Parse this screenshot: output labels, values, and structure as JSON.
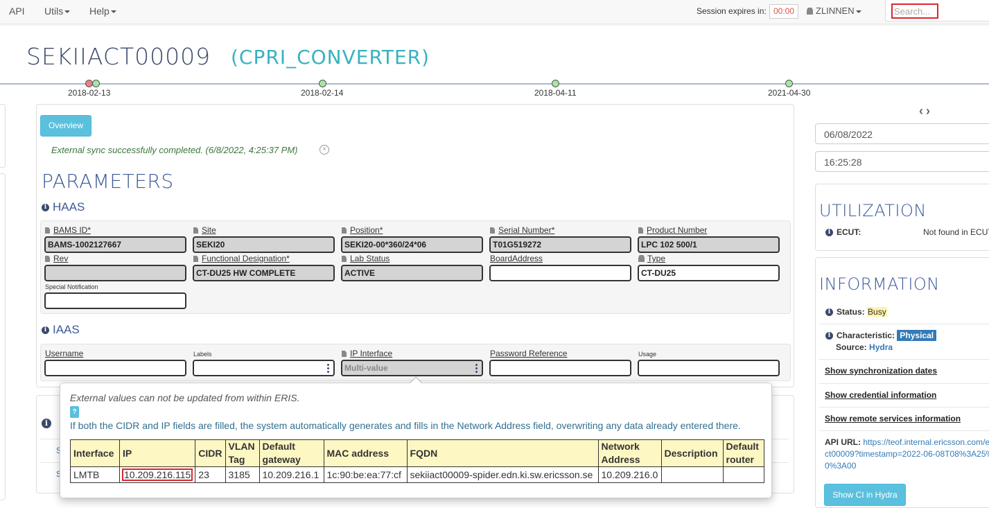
{
  "nav": {
    "api": "API",
    "utils": "Utils",
    "help": "Help",
    "session_label": "Session expires in:",
    "session_timer": "00:00",
    "user": "ZLINNEN",
    "search_placeholder": "Search..."
  },
  "ci": {
    "name": "SEKIIACT00009",
    "type": "(CPRI_CONVERTER)"
  },
  "timeline": {
    "dates": [
      "2018-02-13",
      "2018-02-14",
      "2018-04-11",
      "2021-04-30"
    ],
    "colors": {
      "red": "#f08080",
      "green": "#a8e6a0"
    }
  },
  "main": {
    "overview_button": "Overview",
    "sync_message": "External sync successfully completed. (6/8/2022, 4:25:37 PM)",
    "parameters_heading": "PARAMETERS",
    "haas": {
      "heading": "HAAS",
      "fields": [
        {
          "label": "BAMS ID*",
          "value": "BAMS-1002127667"
        },
        {
          "label": "Site",
          "value": "SEKI20"
        },
        {
          "label": "Position*",
          "value": "SEKI20-00*360/24*06"
        },
        {
          "label": "Serial Number*",
          "value": "T01G519272"
        },
        {
          "label": "Product Number",
          "value": "LPC 102 500/1"
        },
        {
          "label": "Rev",
          "value": ""
        },
        {
          "label": "Functional Designation*",
          "value": "CT-DU25 HW COMPLETE"
        },
        {
          "label": "Lab Status",
          "value": "ACTIVE"
        },
        {
          "label": "BoardAddress",
          "value": ""
        },
        {
          "label": "Type",
          "value": "CT-DU25"
        },
        {
          "label": "Special Notification",
          "value": ""
        }
      ]
    },
    "iaas": {
      "heading": "IAAS",
      "fields": [
        {
          "label": "Username",
          "value": ""
        },
        {
          "label": "Labels",
          "value": ""
        },
        {
          "label": "IP Interface",
          "value": "Multi-value"
        },
        {
          "label": "Password Reference",
          "value": ""
        },
        {
          "label": "Usage",
          "value": ""
        }
      ]
    }
  },
  "right": {
    "date": "06/08/2022",
    "time": "16:25:28",
    "utilization": {
      "heading": "UTILIZATION",
      "ecut_label": "ECUT:",
      "ecut_value": "Not found in ECUT"
    },
    "information": {
      "heading": "INFORMATION",
      "status_label": "Status:",
      "status_value": "Busy",
      "characteristic_label": "Characteristic:",
      "characteristic_value": "Physical",
      "source_label": "Source:",
      "source_value": "Hydra",
      "link_sync": "Show synchronization dates",
      "link_cred": "Show credential information",
      "link_remote": "Show remote services information",
      "api_label": "API URL:",
      "api_line1": "https://teof.internal.ericsson.com/e",
      "api_line2": "ct00009?timestamp=2022-06-08T08%3A25%",
      "api_line3": "0%3A00",
      "hydra_button": "Show CI in Hydra"
    }
  },
  "popover": {
    "note": "External values can not be updated from within ERIS.",
    "help_badge": "?",
    "description": "If both the CIDR and IP fields are filled, the system automatically generates and fills in the Network Address field, overwriting any data already entered there.",
    "table": {
      "headers": [
        "Interface",
        "IP",
        "CIDR",
        "VLAN Tag",
        "Default gateway",
        "MAC address",
        "FQDN",
        "Network Address",
        "Description",
        "Default router"
      ],
      "row": [
        "LMTB",
        "10.209.216.115",
        "23",
        "3185",
        "10.209.216.1",
        "1c:90:be:ea:77:cf",
        "sekiiact00009-spider.edn.ki.sw.ericsson.se",
        "10.209.216.0",
        "",
        ""
      ]
    }
  },
  "lower": {
    "link_s1": "S",
    "link_s2": "S"
  }
}
